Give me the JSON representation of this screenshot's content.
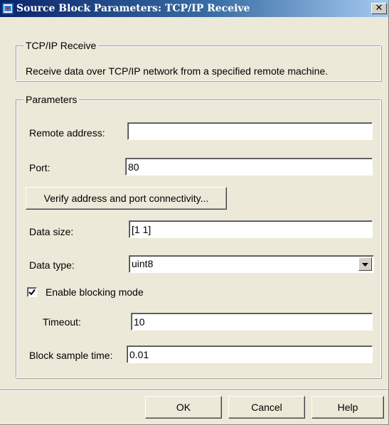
{
  "window": {
    "title": "Source Block Parameters: TCP/IP Receive",
    "close_glyph": "✕"
  },
  "description_group": {
    "legend": "TCP/IP Receive",
    "text": "Receive data over TCP/IP network from a specified remote machine."
  },
  "parameters": {
    "legend": "Parameters",
    "remote_address": {
      "label": "Remote address:",
      "value": ""
    },
    "port": {
      "label": "Port:",
      "value": "80"
    },
    "verify_button": "Verify address and port connectivity...",
    "data_size": {
      "label": "Data size:",
      "value": "[1 1]"
    },
    "data_type": {
      "label": "Data type:",
      "value": "uint8"
    },
    "blocking": {
      "label": "Enable blocking mode",
      "checked": true
    },
    "timeout": {
      "label": "Timeout:",
      "value": "10"
    },
    "sample_time": {
      "label": "Block sample time:",
      "value": "0.01"
    }
  },
  "buttons": {
    "ok": "OK",
    "cancel": "Cancel",
    "help": "Help"
  },
  "colors": {
    "title_bar_start": "#0a246a",
    "title_bar_end": "#a6caf0",
    "dialog_bg": "#ece9d8"
  },
  "icons": {
    "title": "simulink-block-icon",
    "dropdown": "chevron-down-icon",
    "checkmark": "checkmark-icon"
  }
}
